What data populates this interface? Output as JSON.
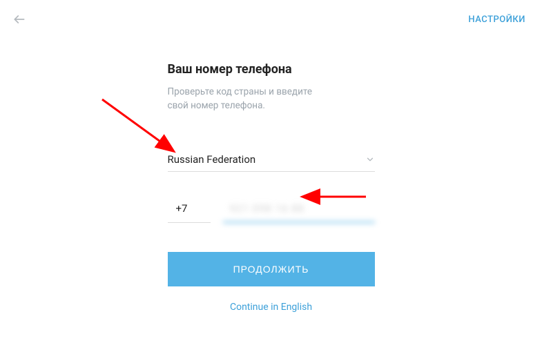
{
  "header": {
    "settings_label": "НАСТРОЙКИ"
  },
  "main": {
    "title": "Ваш номер телефона",
    "subtitle_line1": "Проверьте код страны и введите",
    "subtitle_line2": "свой номер телефона."
  },
  "country": {
    "selected": "Russian Federation"
  },
  "phone": {
    "code": "+7",
    "number_masked": "921 098 16 88"
  },
  "actions": {
    "continue_label": "ПРОДОЛЖИТЬ",
    "language_switch": "Continue in English"
  }
}
